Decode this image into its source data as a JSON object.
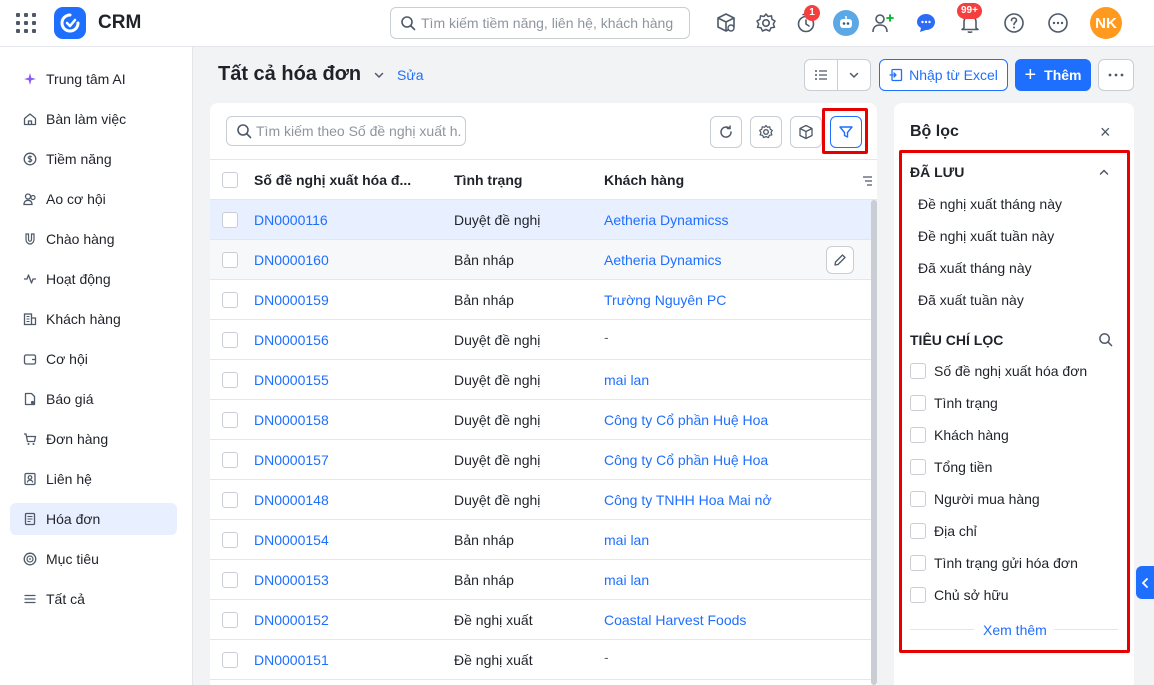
{
  "app": {
    "name": "CRM",
    "brand_color": "#1f6fff"
  },
  "topbar": {
    "search_placeholder": "Tìm kiếm tiềm năng, liên hệ, khách hàng",
    "timer_badge": "1",
    "notification_badge": "99+",
    "avatar_initials": "NK"
  },
  "sidebar": {
    "items": [
      {
        "label": "Trung tâm AI",
        "icon": "sparkle-icon"
      },
      {
        "label": "Bàn làm việc",
        "icon": "home-icon"
      },
      {
        "label": "Tiềm năng",
        "icon": "dollar-circle-icon"
      },
      {
        "label": "Ao cơ hội",
        "icon": "users-icon"
      },
      {
        "label": "Chào hàng",
        "icon": "magnet-icon"
      },
      {
        "label": "Hoạt động",
        "icon": "activity-icon"
      },
      {
        "label": "Khách hàng",
        "icon": "building-icon"
      },
      {
        "label": "Cơ hội",
        "icon": "wallet-icon"
      },
      {
        "label": "Báo giá",
        "icon": "quote-doc-icon"
      },
      {
        "label": "Đơn hàng",
        "icon": "cart-icon"
      },
      {
        "label": "Liên hệ",
        "icon": "contact-icon"
      },
      {
        "label": "Hóa đơn",
        "icon": "invoice-icon",
        "active": true
      },
      {
        "label": "Mục tiêu",
        "icon": "target-icon"
      },
      {
        "label": "Tất cả",
        "icon": "menu-icon"
      }
    ]
  },
  "header": {
    "title": "Tất cả hóa đơn",
    "edit_label": "Sửa",
    "import_label": "Nhập từ Excel",
    "add_label": "Thêm"
  },
  "table": {
    "search_placeholder": "Tìm kiếm theo Số đề nghị xuất h...",
    "columns": [
      "Số đề nghị xuất hóa đ...",
      "Tình trạng",
      "Khách hàng"
    ],
    "rows": [
      {
        "code": "DN0000116",
        "status": "Duyệt đề nghị",
        "customer": "Aetheria Dynamicss"
      },
      {
        "code": "DN0000160",
        "status": "Bản nháp",
        "customer": "Aetheria Dynamics"
      },
      {
        "code": "DN0000159",
        "status": "Bản nháp",
        "customer": "Trường Nguyên PC"
      },
      {
        "code": "DN0000156",
        "status": "Duyệt đề nghị",
        "customer": "-"
      },
      {
        "code": "DN0000155",
        "status": "Duyệt đề nghị",
        "customer": "mai lan"
      },
      {
        "code": "DN0000158",
        "status": "Duyệt đề nghị",
        "customer": "Công ty Cổ phần Huệ Hoa"
      },
      {
        "code": "DN0000157",
        "status": "Duyệt đề nghị",
        "customer": "Công ty Cổ phần Huệ Hoa"
      },
      {
        "code": "DN0000148",
        "status": "Duyệt đề nghị",
        "customer": "Công ty TNHH Hoa Mai nở"
      },
      {
        "code": "DN0000154",
        "status": "Bản nháp",
        "customer": "mai lan"
      },
      {
        "code": "DN0000153",
        "status": "Bản nháp",
        "customer": "mai lan"
      },
      {
        "code": "DN0000152",
        "status": "Đề nghị xuất",
        "customer": "Coastal Harvest Foods"
      },
      {
        "code": "DN0000151",
        "status": "Đề nghị xuất",
        "customer": "-"
      }
    ]
  },
  "filter_panel": {
    "title": "Bộ lọc",
    "saved_title": "ĐÃ LƯU",
    "saved_items": [
      "Đề nghị xuất tháng này",
      "Đề nghị xuất tuần này",
      "Đã xuất tháng này",
      "Đã xuất tuần này"
    ],
    "criteria_title": "TIÊU CHÍ LỌC",
    "criteria": [
      "Số đề nghị xuất hóa đơn",
      "Tình trạng",
      "Khách hàng",
      "Tổng tiền",
      "Người mua hàng",
      "Địa chỉ",
      "Tình trạng gửi hóa đơn",
      "Chủ sở hữu"
    ],
    "see_more": "Xem thêm"
  },
  "highlight_color": "#e60000"
}
